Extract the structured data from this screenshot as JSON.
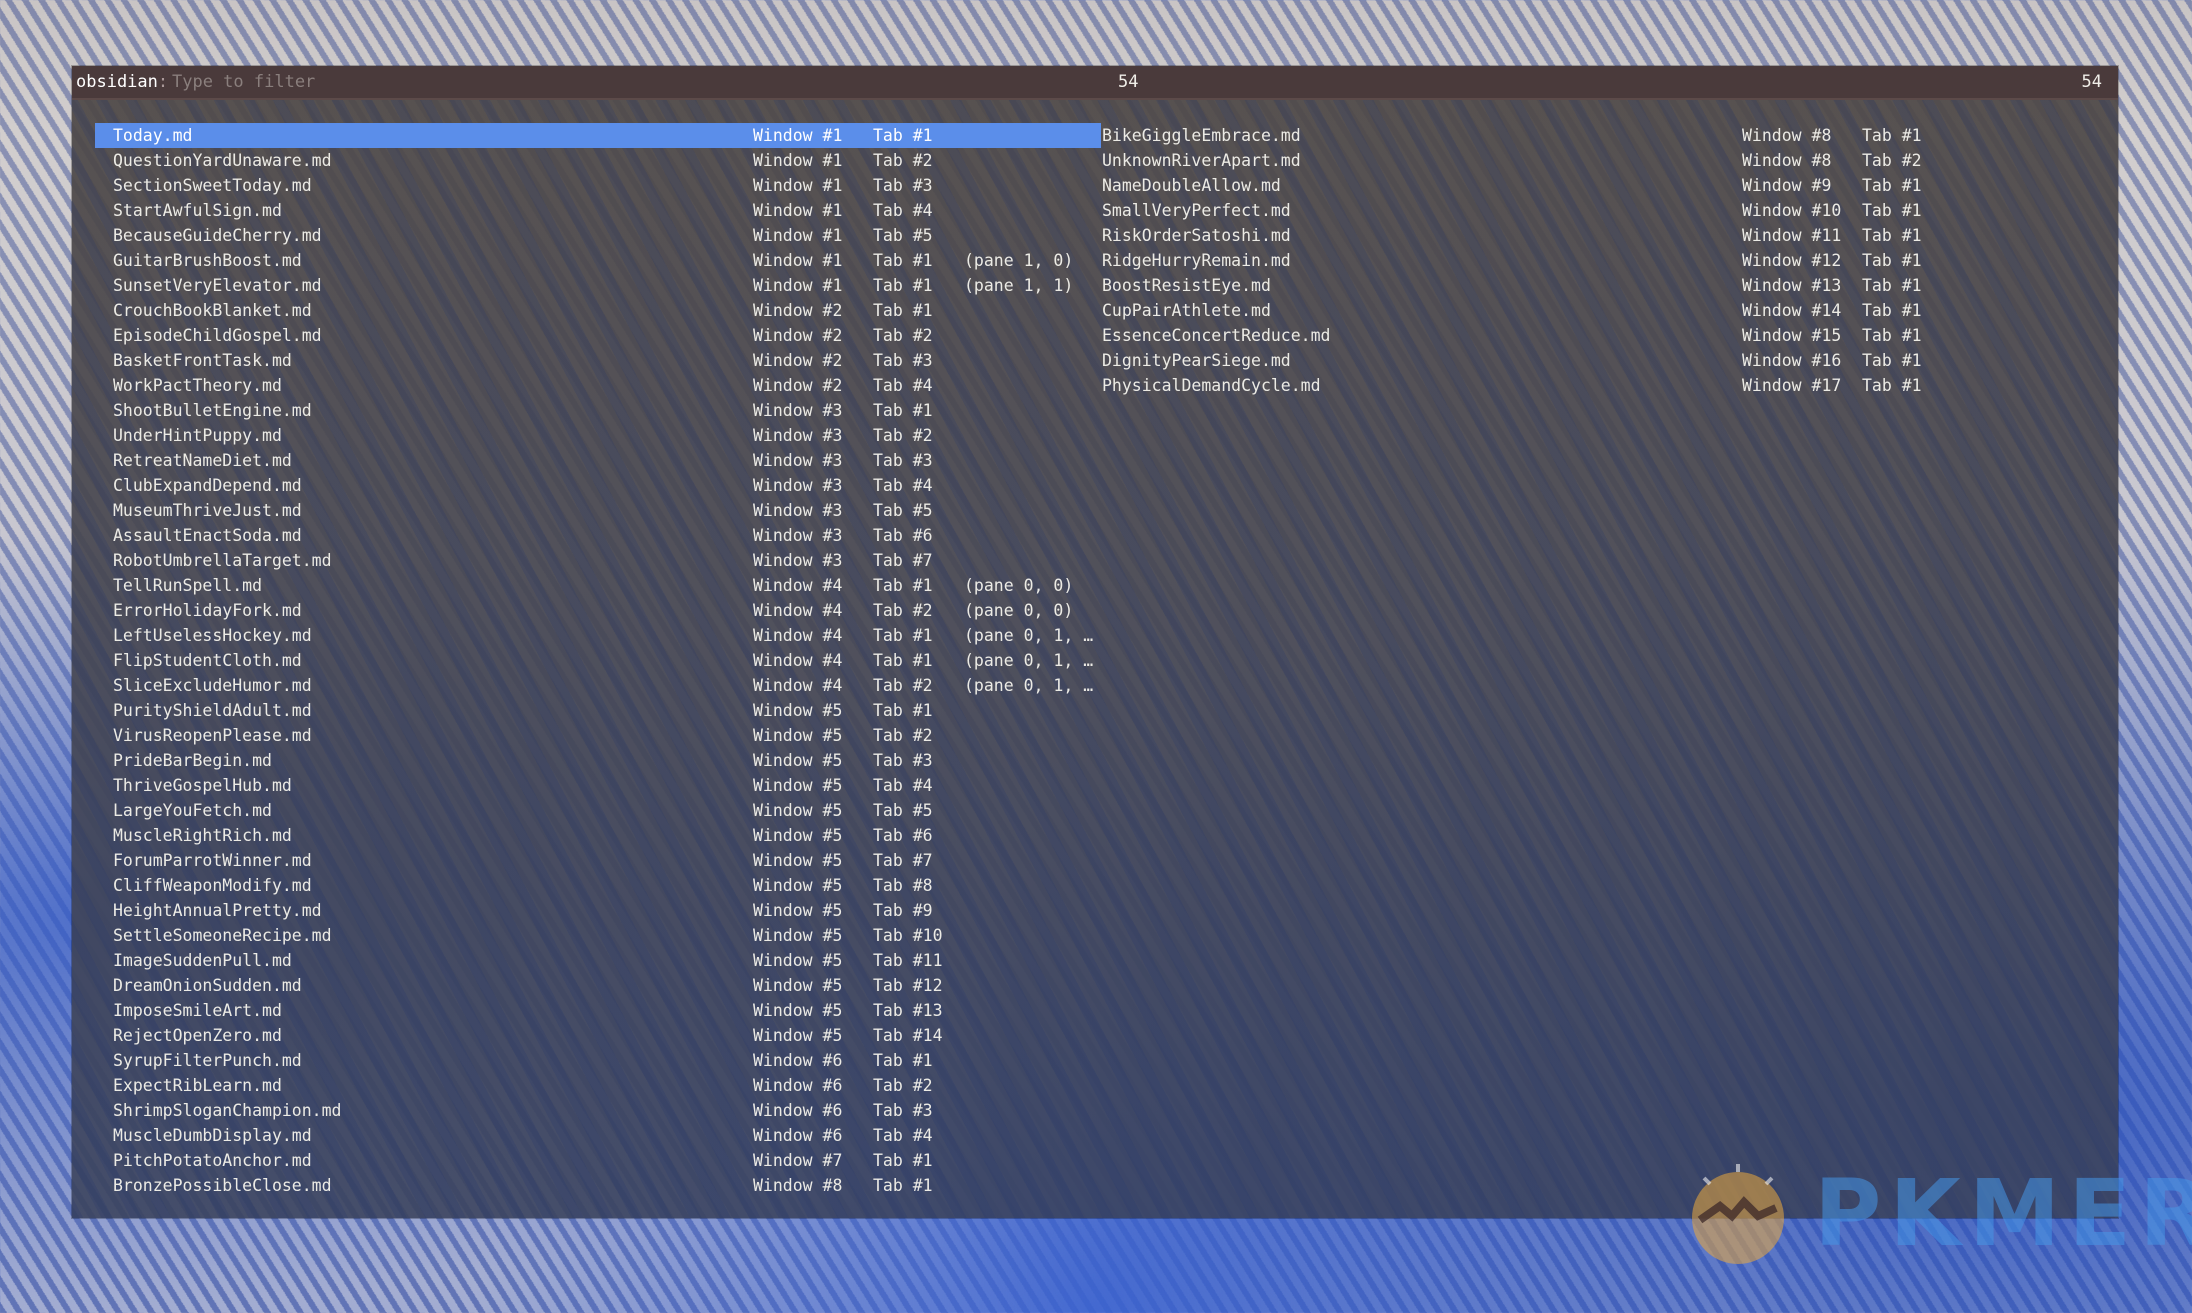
{
  "prompt": {
    "label": "obsidian",
    "placeholder": "Type to filter",
    "match_count": "54",
    "total_count": "54"
  },
  "left_rows": [
    {
      "name": "Today.md",
      "window": "Window #1",
      "tab": "Tab #1",
      "pane": ""
    },
    {
      "name": "QuestionYardUnaware.md",
      "window": "Window #1",
      "tab": "Tab #2",
      "pane": ""
    },
    {
      "name": "SectionSweetToday.md",
      "window": "Window #1",
      "tab": "Tab #3",
      "pane": ""
    },
    {
      "name": "StartAwfulSign.md",
      "window": "Window #1",
      "tab": "Tab #4",
      "pane": ""
    },
    {
      "name": "BecauseGuideCherry.md",
      "window": "Window #1",
      "tab": "Tab #5",
      "pane": ""
    },
    {
      "name": "GuitarBrushBoost.md",
      "window": "Window #1",
      "tab": "Tab #1",
      "pane": "(pane 1, 0)"
    },
    {
      "name": "SunsetVeryElevator.md",
      "window": "Window #1",
      "tab": "Tab #1",
      "pane": "(pane 1, 1)"
    },
    {
      "name": "CrouchBookBlanket.md",
      "window": "Window #2",
      "tab": "Tab #1",
      "pane": ""
    },
    {
      "name": "EpisodeChildGospel.md",
      "window": "Window #2",
      "tab": "Tab #2",
      "pane": ""
    },
    {
      "name": "BasketFrontTask.md",
      "window": "Window #2",
      "tab": "Tab #3",
      "pane": ""
    },
    {
      "name": "WorkPactTheory.md",
      "window": "Window #2",
      "tab": "Tab #4",
      "pane": ""
    },
    {
      "name": "ShootBulletEngine.md",
      "window": "Window #3",
      "tab": "Tab #1",
      "pane": ""
    },
    {
      "name": "UnderHintPuppy.md",
      "window": "Window #3",
      "tab": "Tab #2",
      "pane": ""
    },
    {
      "name": "RetreatNameDiet.md",
      "window": "Window #3",
      "tab": "Tab #3",
      "pane": ""
    },
    {
      "name": "ClubExpandDepend.md",
      "window": "Window #3",
      "tab": "Tab #4",
      "pane": ""
    },
    {
      "name": "MuseumThriveJust.md",
      "window": "Window #3",
      "tab": "Tab #5",
      "pane": ""
    },
    {
      "name": "AssaultEnactSoda.md",
      "window": "Window #3",
      "tab": "Tab #6",
      "pane": ""
    },
    {
      "name": "RobotUmbrellaTarget.md",
      "window": "Window #3",
      "tab": "Tab #7",
      "pane": ""
    },
    {
      "name": "TellRunSpell.md",
      "window": "Window #4",
      "tab": "Tab #1",
      "pane": "(pane 0, 0)"
    },
    {
      "name": "ErrorHolidayFork.md",
      "window": "Window #4",
      "tab": "Tab #2",
      "pane": "(pane 0, 0)"
    },
    {
      "name": "LeftUselessHockey.md",
      "window": "Window #4",
      "tab": "Tab #1",
      "pane": "(pane 0, 1, …"
    },
    {
      "name": "FlipStudentCloth.md",
      "window": "Window #4",
      "tab": "Tab #1",
      "pane": "(pane 0, 1, …"
    },
    {
      "name": "SliceExcludeHumor.md",
      "window": "Window #4",
      "tab": "Tab #2",
      "pane": "(pane 0, 1, …"
    },
    {
      "name": "PurityShieldAdult.md",
      "window": "Window #5",
      "tab": "Tab #1",
      "pane": ""
    },
    {
      "name": "VirusReopenPlease.md",
      "window": "Window #5",
      "tab": "Tab #2",
      "pane": ""
    },
    {
      "name": "PrideBarBegin.md",
      "window": "Window #5",
      "tab": "Tab #3",
      "pane": ""
    },
    {
      "name": "ThriveGospelHub.md",
      "window": "Window #5",
      "tab": "Tab #4",
      "pane": ""
    },
    {
      "name": "LargeYouFetch.md",
      "window": "Window #5",
      "tab": "Tab #5",
      "pane": ""
    },
    {
      "name": "MuscleRightRich.md",
      "window": "Window #5",
      "tab": "Tab #6",
      "pane": ""
    },
    {
      "name": "ForumParrotWinner.md",
      "window": "Window #5",
      "tab": "Tab #7",
      "pane": ""
    },
    {
      "name": "CliffWeaponModify.md",
      "window": "Window #5",
      "tab": "Tab #8",
      "pane": ""
    },
    {
      "name": "HeightAnnualPretty.md",
      "window": "Window #5",
      "tab": "Tab #9",
      "pane": ""
    },
    {
      "name": "SettleSomeoneRecipe.md",
      "window": "Window #5",
      "tab": "Tab #10",
      "pane": ""
    },
    {
      "name": "ImageSuddenPull.md",
      "window": "Window #5",
      "tab": "Tab #11",
      "pane": ""
    },
    {
      "name": "DreamOnionSudden.md",
      "window": "Window #5",
      "tab": "Tab #12",
      "pane": ""
    },
    {
      "name": "ImposeSmileArt.md",
      "window": "Window #5",
      "tab": "Tab #13",
      "pane": ""
    },
    {
      "name": "RejectOpenZero.md",
      "window": "Window #5",
      "tab": "Tab #14",
      "pane": ""
    },
    {
      "name": "SyrupFilterPunch.md",
      "window": "Window #6",
      "tab": "Tab #1",
      "pane": ""
    },
    {
      "name": "ExpectRibLearn.md",
      "window": "Window #6",
      "tab": "Tab #2",
      "pane": ""
    },
    {
      "name": "ShrimpSloganChampion.md",
      "window": "Window #6",
      "tab": "Tab #3",
      "pane": ""
    },
    {
      "name": "MuscleDumbDisplay.md",
      "window": "Window #6",
      "tab": "Tab #4",
      "pane": ""
    },
    {
      "name": "PitchPotatoAnchor.md",
      "window": "Window #7",
      "tab": "Tab #1",
      "pane": ""
    },
    {
      "name": "BronzePossibleClose.md",
      "window": "Window #8",
      "tab": "Tab #1",
      "pane": ""
    }
  ],
  "right_rows": [
    {
      "name": "BikeGiggleEmbrace.md",
      "window": "Window #8",
      "tab": "Tab #1"
    },
    {
      "name": "UnknownRiverApart.md",
      "window": "Window #8",
      "tab": "Tab #2"
    },
    {
      "name": "NameDoubleAllow.md",
      "window": "Window #9",
      "tab": "Tab #1"
    },
    {
      "name": "SmallVeryPerfect.md",
      "window": "Window #10",
      "tab": "Tab #1"
    },
    {
      "name": "RiskOrderSatoshi.md",
      "window": "Window #11",
      "tab": "Tab #1"
    },
    {
      "name": "RidgeHurryRemain.md",
      "window": "Window #12",
      "tab": "Tab #1"
    },
    {
      "name": "BoostResistEye.md",
      "window": "Window #13",
      "tab": "Tab #1"
    },
    {
      "name": "CupPairAthlete.md",
      "window": "Window #14",
      "tab": "Tab #1"
    },
    {
      "name": "EssenceConcertReduce.md",
      "window": "Window #15",
      "tab": "Tab #1"
    },
    {
      "name": "DignityPearSiege.md",
      "window": "Window #16",
      "tab": "Tab #1"
    },
    {
      "name": "PhysicalDemandCycle.md",
      "window": "Window #17",
      "tab": "Tab #1"
    }
  ],
  "selected_index": 0,
  "watermark": {
    "text": "PKMER",
    "icon": "mountain-sun-logo-icon"
  },
  "colors": {
    "selection": "#5b8eea",
    "prompt_bar": "#4a3a3b",
    "text": "#ecebe5"
  }
}
